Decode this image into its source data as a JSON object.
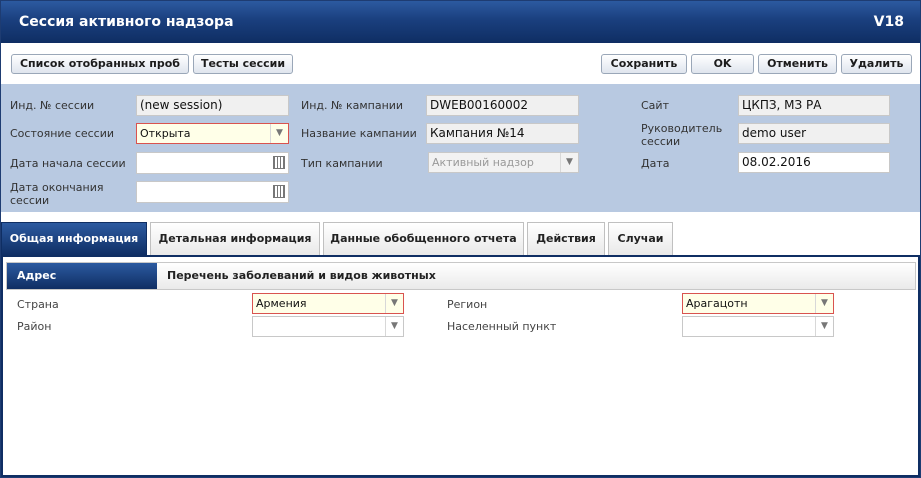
{
  "window": {
    "title": "Сессия активного надзора",
    "version": "V18"
  },
  "toolbar": {
    "samples_list": "Список отобранных проб",
    "session_tests": "Тесты сессии",
    "save": "Сохранить",
    "ok": "OK",
    "cancel": "Отменить",
    "delete": "Удалить"
  },
  "form": {
    "session_id_label": "Инд. № сессии",
    "session_id_value": "(new session)",
    "session_state_label": "Состояние сессии",
    "session_state_value": "Открыта",
    "start_date_label": "Дата начала сессии",
    "start_date_value": "",
    "end_date_label": "Дата окончания сессии",
    "end_date_value": "",
    "campaign_id_label": "Инд. № кампании",
    "campaign_id_value": "DWEB00160002",
    "campaign_name_label": "Название кампании",
    "campaign_name_value": "Кампания №14",
    "campaign_type_label": "Тип кампании",
    "campaign_type_value": "Активный надзор",
    "site_label": "Сайт",
    "site_value": "ЦКПЗ, МЗ РА",
    "officer_label": "Руководитель сессии",
    "officer_value": "demo user",
    "date_label": "Дата",
    "date_value": "08.02.2016"
  },
  "tabs": [
    {
      "label": "Общая информация"
    },
    {
      "label": "Детальная информация"
    },
    {
      "label": "Данные обобщенного отчета"
    },
    {
      "label": "Действия"
    },
    {
      "label": "Случаи"
    }
  ],
  "subtabs": [
    {
      "label": "Адрес"
    },
    {
      "label": "Перечень заболеваний и видов животных"
    }
  ],
  "address": {
    "country_label": "Страна",
    "country_value": "Армения",
    "region_label": "Регион",
    "region_value": "Арагацотн",
    "district_label": "Район",
    "district_value": "",
    "settlement_label": "Населенный пункт",
    "settlement_value": ""
  }
}
